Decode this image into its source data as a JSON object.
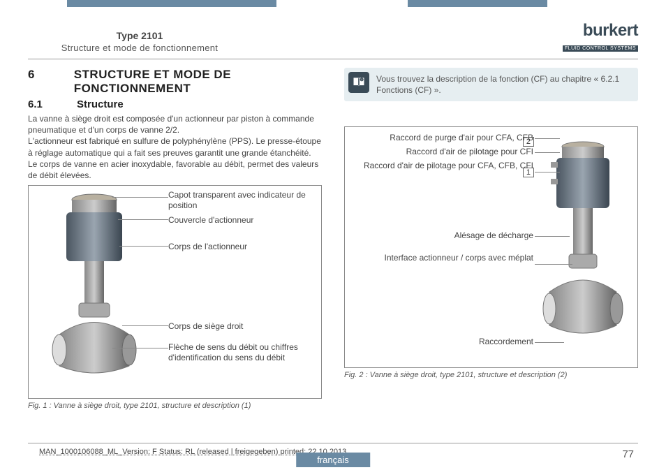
{
  "header": {
    "type": "Type 2101",
    "section": "Structure et mode de fonctionnement",
    "logo_main": "burkert",
    "logo_sub": "FLUID CONTROL SYSTEMS"
  },
  "h1": {
    "num": "6",
    "text": "STRUCTURE ET MODE DE FONCTIONNEMENT"
  },
  "h2": {
    "num": "6.1",
    "text": "Structure"
  },
  "p1": "La vanne à siège droit est composée d'un actionneur par piston à commande pneumatique et d'un corps de vanne 2/2.",
  "p2": "L'actionneur est fabriqué en sulfure de polyphénylène (PPS). Le presse-étoupe à réglage automatique qui a fait ses preuves garantit une grande étanchéité. Le corps de vanne en acier inoxydable, favorable au débit, permet des valeurs de débit élevées.",
  "fig1": {
    "labels": {
      "l1": "Capot transparent avec indicateur de position",
      "l2": "Couvercle d'actionneur",
      "l3": "Corps de l'actionneur",
      "l4": "Corps de siège droit",
      "l5": "Flèche de sens du débit ou chiffres d'identification du sens du débit"
    },
    "caption": "Fig. 1 :   Vanne à siège droit, type 2101, structure et description (1)"
  },
  "note": "Vous trouvez la description de la fonction (CF) au chapitre « 6.2.1 Fonctions (CF) ».",
  "fig2": {
    "labels": {
      "l1": "Raccord de purge d'air pour CFA, CFB",
      "l2": "Raccord d'air de pilotage pour CFI",
      "l3": "Raccord d'air de pilotage pour CFA, CFB, CFI",
      "l4": "Alésage de décharge",
      "l5": "Interface actionneur / corps avec méplat",
      "l6": "Raccordement"
    },
    "num1": "1",
    "num2": "2",
    "caption": "Fig. 2 :   Vanne à siège droit, type 2101, structure et description (2)"
  },
  "footer": {
    "version": "MAN_1000106088_ML_Version: F Status: RL (released | freigegeben)  printed: 22.10.2013",
    "lang": "français",
    "page": "77"
  }
}
